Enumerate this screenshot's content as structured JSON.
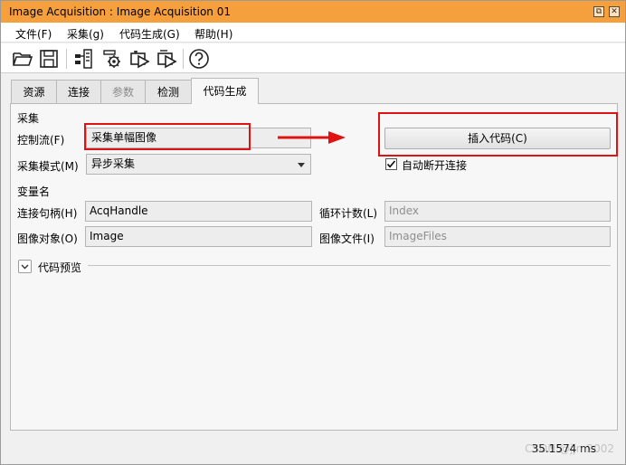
{
  "window": {
    "title": "Image Acquisition : Image Acquisition 01",
    "restore_glyph": "⧉",
    "close_glyph": "✕"
  },
  "menu": {
    "file": "文件(F)",
    "acquire": "采集(g)",
    "codegen": "代码生成(G)",
    "help": "帮助(H)"
  },
  "toolbar": {
    "icons": [
      "open-folder-icon",
      "save-icon",
      "connect-icon",
      "settings-icon",
      "snap-icon",
      "live-icon",
      "help-icon"
    ]
  },
  "tabs": {
    "resource": "资源",
    "connection": "连接",
    "parameters": "参数",
    "inspect": "检测",
    "codegen": "代码生成"
  },
  "acquisition": {
    "section_title": "采集",
    "control_flow_label": "控制流(F)",
    "control_flow_value": "采集单幅图像",
    "mode_label": "采集模式(M)",
    "mode_value": "异步采集",
    "insert_code_button": "插入代码(C)",
    "auto_disconnect_label": "自动断开连接",
    "auto_disconnect_checked": true
  },
  "variables": {
    "section_title": "变量名",
    "handle_label": "连接句柄(H)",
    "handle_value": "AcqHandle",
    "loop_label": "循环计数(L)",
    "loop_placeholder": "Index",
    "image_label": "图像对象(O)",
    "image_value": "Image",
    "file_label": "图像文件(I)",
    "file_placeholder": "ImageFiles"
  },
  "preview": {
    "label": "代码预览"
  },
  "status": {
    "time": "35.1574 ms",
    "watermark": "CSDN @jjm2002"
  },
  "colors": {
    "titlebar": "#f5a03c",
    "highlight": "#e11212"
  }
}
